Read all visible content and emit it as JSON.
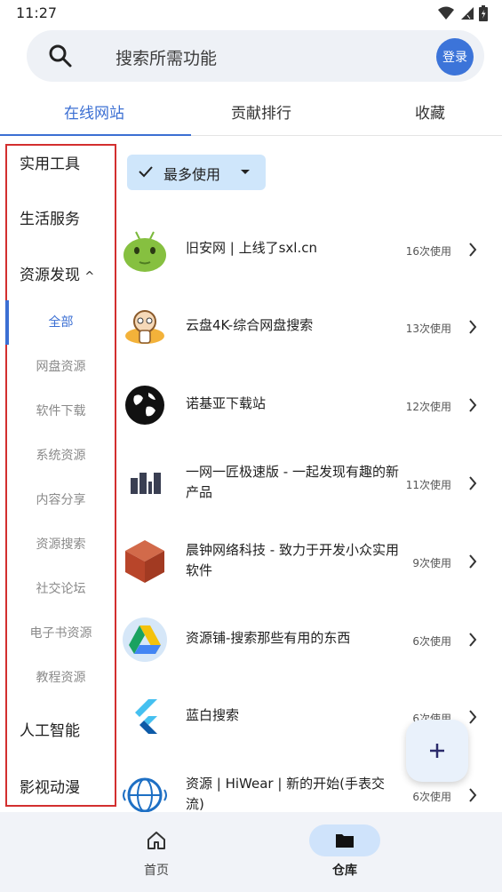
{
  "status_bar": {
    "time": "11:27"
  },
  "search": {
    "placeholder": "搜索所需功能",
    "login_label": "登录"
  },
  "tabs": [
    {
      "label": "在线网站",
      "active": true
    },
    {
      "label": "贡献排行",
      "active": false
    },
    {
      "label": "收藏",
      "active": false
    }
  ],
  "sidebar": {
    "categories": [
      "实用工具",
      "生活服务",
      "资源发现",
      "人工智能",
      "影视动漫"
    ],
    "expanded_caret": "^",
    "subcategories": [
      "全部",
      "网盘资源",
      "软件下载",
      "系统资源",
      "内容分享",
      "资源搜索",
      "社交论坛",
      "电子书资源",
      "教程资源"
    ],
    "active_subcategory": "全部"
  },
  "filter": {
    "label": "最多使用"
  },
  "list": [
    {
      "title": "旧安网 | 上线了sxl.cn",
      "count": "16次使用",
      "icon": "android-robot-icon"
    },
    {
      "title": "云盘4K-综合网盘搜索",
      "count": "13次使用",
      "icon": "cartoon-mascot-icon"
    },
    {
      "title": "诺基亚下载站",
      "count": "12次使用",
      "icon": "globe-icon"
    },
    {
      "title": "一网一匠极速版 - 一起发现有趣的新产品",
      "count": "11次使用",
      "icon": "bars-logo-icon"
    },
    {
      "title": "晨钟网络科技 - 致力于开发小众实用软件",
      "count": "9次使用",
      "icon": "cube-icon"
    },
    {
      "title": "资源铺-搜索那些有用的东西",
      "count": "6次使用",
      "icon": "drive-triangle-icon"
    },
    {
      "title": "蓝白搜索",
      "count": "6次使用",
      "icon": "flutter-icon"
    },
    {
      "title": "资源 | HiWear | 新的开始(手表交流)",
      "count": "6次使用",
      "icon": "sphere-logo-icon"
    }
  ],
  "bottom_nav": [
    {
      "label": "首页",
      "icon": "home-icon"
    },
    {
      "label": "仓库",
      "icon": "folder-icon",
      "active": true
    }
  ],
  "colors": {
    "accent": "#3b6fd3",
    "highlight_border": "#d32f2f",
    "chip_bg": "#cfe6fb"
  }
}
